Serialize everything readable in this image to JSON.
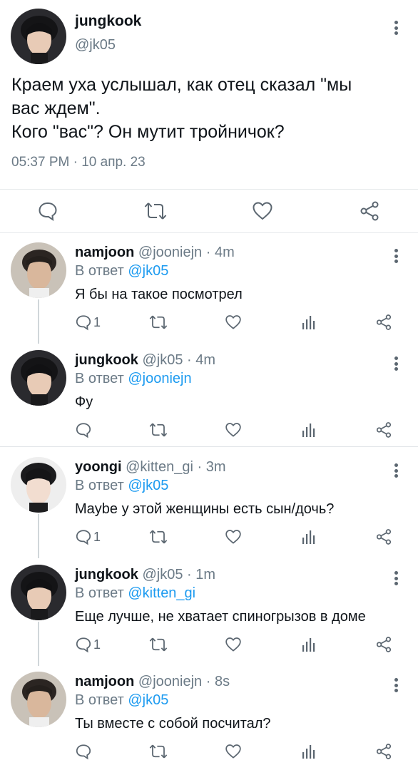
{
  "main_tweet": {
    "name": "jungkook",
    "handle": "@jk05",
    "text": "Краем уха услышал, как отец сказал \"мы\nвас ждем\".\nКого \"вас\"? Он мутит тройничок?",
    "time": "05:37 PM",
    "separator": "·",
    "date": "10 апр. 23",
    "actions": [
      "comment-icon",
      "retweet-icon",
      "heart-icon",
      "share-icon"
    ]
  },
  "replies": [
    {
      "name": "namjoon",
      "handle": "@jooniejn",
      "dot": "·",
      "time": "4m",
      "reply_prefix": "В ответ",
      "reply_to": "@jk05",
      "text": "Я бы на такое посмотрел",
      "comment_count": "1",
      "avatar": "avatar-namjoon"
    },
    {
      "name": "jungkook",
      "handle": "@jk05",
      "dot": "·",
      "time": "4m",
      "reply_prefix": "В ответ",
      "reply_to": "@jooniejn",
      "text": "Фу",
      "comment_count": "",
      "avatar": "avatar-jungkook"
    },
    {
      "name": "yoongi",
      "handle": "@kitten_gi",
      "dot": "·",
      "time": "3m",
      "reply_prefix": "В ответ",
      "reply_to": "@jk05",
      "text": "Maybe у этой женщины есть сын/дочь?",
      "comment_count": "1",
      "avatar": "avatar-yoongi"
    },
    {
      "name": "jungkook",
      "handle": "@jk05",
      "dot": "·",
      "time": "1m",
      "reply_prefix": "В ответ",
      "reply_to": "@kitten_gi",
      "text": "Еще лучше, не хватает спиногрызов в доме",
      "comment_count": "1",
      "avatar": "avatar-jungkook"
    },
    {
      "name": "namjoon",
      "handle": "@jooniejn",
      "dot": "·",
      "time": "8s",
      "reply_prefix": "В ответ",
      "reply_to": "@jk05",
      "text": "Ты вместе с собой посчитал?",
      "comment_count": "",
      "avatar": "avatar-namjoon"
    }
  ],
  "colors": {
    "link": "#1d9bf0",
    "secondary_text": "#6b7a86",
    "icon": "#5b6670",
    "divider": "#e1e5e8"
  }
}
